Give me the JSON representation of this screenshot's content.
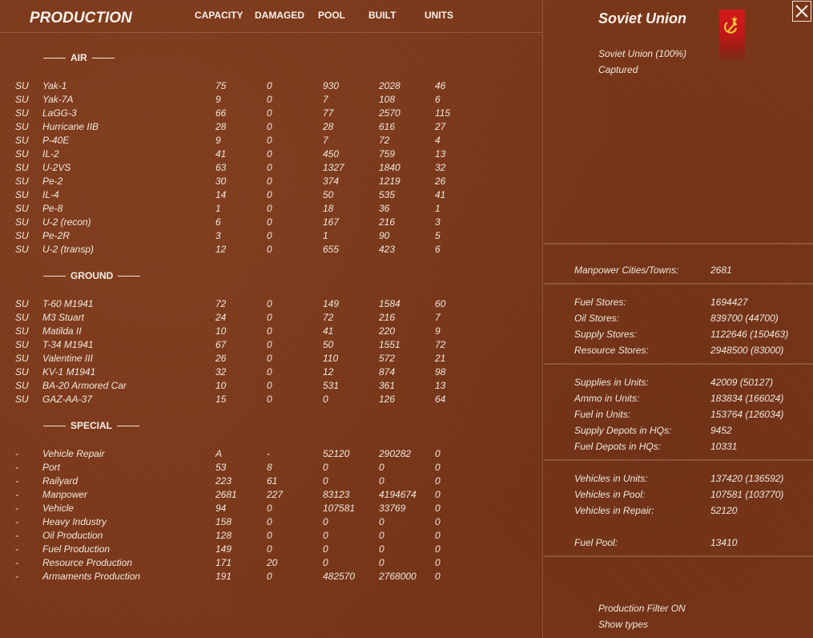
{
  "header": {
    "title": "PRODUCTION",
    "columns": [
      "CAPACITY",
      "DAMAGED",
      "POOL",
      "BUILT",
      "UNITS"
    ]
  },
  "sections": [
    {
      "name": "AIR",
      "rows": [
        [
          "SU",
          "Yak-1",
          "75",
          "0",
          "930",
          "2028",
          "46"
        ],
        [
          "SU",
          "Yak-7A",
          "9",
          "0",
          "7",
          "108",
          "6"
        ],
        [
          "SU",
          "LaGG-3",
          "66",
          "0",
          "77",
          "2570",
          "115"
        ],
        [
          "SU",
          "Hurricane IIB",
          "28",
          "0",
          "28",
          "616",
          "27"
        ],
        [
          "SU",
          "P-40E",
          "9",
          "0",
          "7",
          "72",
          "4"
        ],
        [
          "SU",
          "IL-2",
          "41",
          "0",
          "450",
          "759",
          "13"
        ],
        [
          "SU",
          "U-2VS",
          "63",
          "0",
          "1327",
          "1840",
          "32"
        ],
        [
          "SU",
          "Pe-2",
          "30",
          "0",
          "374",
          "1219",
          "26"
        ],
        [
          "SU",
          "IL-4",
          "14",
          "0",
          "50",
          "535",
          "41"
        ],
        [
          "SU",
          "Pe-8",
          "1",
          "0",
          "18",
          "36",
          "1"
        ],
        [
          "SU",
          "U-2 (recon)",
          "6",
          "0",
          "167",
          "216",
          "3"
        ],
        [
          "SU",
          "Pe-2R",
          "3",
          "0",
          "1",
          "90",
          "5"
        ],
        [
          "SU",
          "U-2 (transp)",
          "12",
          "0",
          "655",
          "423",
          "6"
        ]
      ]
    },
    {
      "name": "GROUND",
      "rows": [
        [
          "SU",
          "T-60 M1941",
          "72",
          "0",
          "149",
          "1584",
          "60"
        ],
        [
          "SU",
          "M3 Stuart",
          "24",
          "0",
          "72",
          "216",
          "7"
        ],
        [
          "SU",
          "Matilda II",
          "10",
          "0",
          "41",
          "220",
          "9"
        ],
        [
          "SU",
          "T-34 M1941",
          "67",
          "0",
          "50",
          "1551",
          "72"
        ],
        [
          "SU",
          "Valentine III",
          "26",
          "0",
          "110",
          "572",
          "21"
        ],
        [
          "SU",
          "KV-1 M1941",
          "32",
          "0",
          "12",
          "874",
          "98"
        ],
        [
          "SU",
          "BA-20 Armored Car",
          "10",
          "0",
          "531",
          "361",
          "13"
        ],
        [
          "SU",
          "GAZ-AA-37",
          "15",
          "0",
          "0",
          "126",
          "64"
        ]
      ]
    },
    {
      "name": "SPECIAL",
      "rows": [
        [
          "-",
          "Vehicle Repair",
          "A",
          "-",
          "52120",
          "290282",
          "0"
        ],
        [
          "-",
          "Port",
          "53",
          "8",
          "0",
          "0",
          "0"
        ],
        [
          "-",
          "Railyard",
          "223",
          "61",
          "0",
          "0",
          "0"
        ],
        [
          "-",
          "Manpower",
          "2681",
          "227",
          "83123",
          "4194674",
          "0"
        ],
        [
          "-",
          "Vehicle",
          "94",
          "0",
          "107581",
          "33769",
          "0"
        ],
        [
          "-",
          "Heavy Industry",
          "158",
          "0",
          "0",
          "0",
          "0"
        ],
        [
          "-",
          "Oil Production",
          "128",
          "0",
          "0",
          "0",
          "0"
        ],
        [
          "-",
          "Fuel Production",
          "149",
          "0",
          "0",
          "0",
          "0"
        ],
        [
          "-",
          "Resource Production",
          "171",
          "20",
          "0",
          "0",
          "0"
        ],
        [
          "-",
          "Armaments Production",
          "191",
          "0",
          "482570",
          "2768000",
          "0"
        ]
      ]
    }
  ],
  "side": {
    "nation": "Soviet Union",
    "control": "Soviet Union  (100%)",
    "status": "Captured",
    "flag_color": "#d21a1a",
    "groups": [
      [
        [
          "Manpower Cities/Towns:",
          "2681"
        ]
      ],
      [
        [
          "Fuel Stores:",
          "1694427"
        ],
        [
          "Oil Stores:",
          "839700 (44700)"
        ],
        [
          "Supply Stores:",
          "1122646 (150463)"
        ],
        [
          "Resource Stores:",
          "2948500 (83000)"
        ]
      ],
      [
        [
          "Supplies in Units:",
          "42009 (50127)"
        ],
        [
          "Ammo in Units:",
          "183834 (166024)"
        ],
        [
          "Fuel in Units:",
          "153764 (126034)"
        ],
        [
          "Supply Depots in HQs:",
          "9452"
        ],
        [
          "Fuel Depots in HQs:",
          "10331"
        ]
      ],
      [
        [
          "Vehicles in Units:",
          "137420 (136592)"
        ],
        [
          "Vehicles in Pool:",
          "107581 (103770)"
        ],
        [
          "Vehicles in Repair:",
          "52120"
        ],
        [
          "",
          ""
        ],
        [
          "Fuel Pool:",
          "13410"
        ]
      ]
    ],
    "footer": [
      "Production Filter ON",
      "Show types"
    ]
  }
}
